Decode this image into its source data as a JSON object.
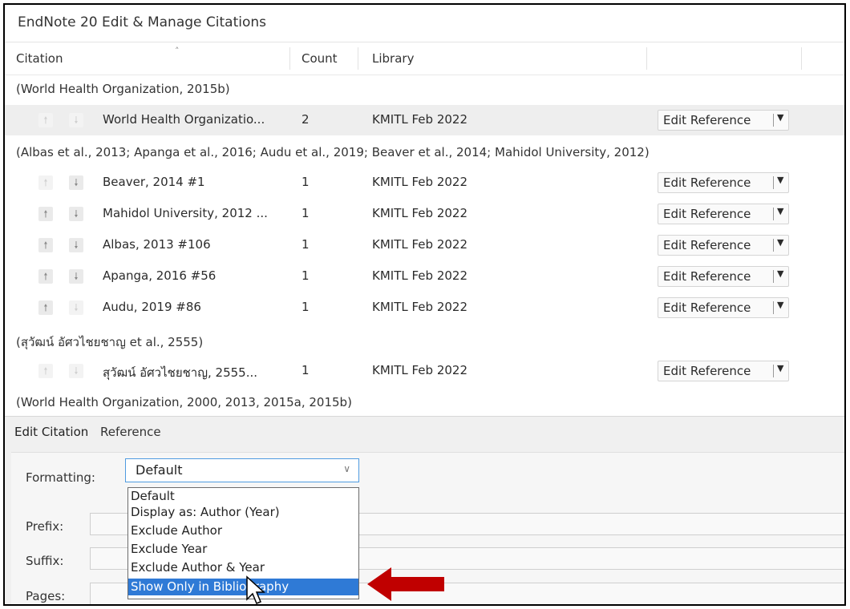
{
  "window": {
    "title": "EndNote 20 Edit & Manage Citations"
  },
  "columns": {
    "citation": "Citation",
    "count": "Count",
    "library": "Library"
  },
  "groups": [
    {
      "header": "(World Health Organization, 2015b)",
      "rows": [
        {
          "citation": "World Health Organizatio...",
          "count": "2",
          "library": "KMITL Feb 2022",
          "action": "Edit Reference"
        }
      ]
    },
    {
      "header": "(Albas et al., 2013; Apanga et al., 2016; Audu et al., 2019; Beaver et al., 2014; Mahidol University, 2012)",
      "rows": [
        {
          "citation": "Beaver, 2014 #1",
          "count": "1",
          "library": "KMITL Feb 2022",
          "action": "Edit Reference"
        },
        {
          "citation": "Mahidol University, 2012 ...",
          "count": "1",
          "library": "KMITL Feb 2022",
          "action": "Edit Reference"
        },
        {
          "citation": "Albas, 2013 #106",
          "count": "1",
          "library": "KMITL Feb 2022",
          "action": "Edit Reference"
        },
        {
          "citation": "Apanga, 2016 #56",
          "count": "1",
          "library": "KMITL Feb 2022",
          "action": "Edit Reference"
        },
        {
          "citation": "Audu, 2019 #86",
          "count": "1",
          "library": "KMITL Feb 2022",
          "action": "Edit Reference"
        }
      ]
    },
    {
      "header": "(สุวัฒน์ อัศวไชยชาญ et al., 2555)",
      "rows": [
        {
          "citation": "สุวัฒน์ อัศวไชยชาญ, 2555...",
          "count": "1",
          "library": "KMITL Feb 2022",
          "action": "Edit Reference"
        }
      ]
    },
    {
      "header": "(World Health Organization, 2000, 2013, 2015a, 2015b)",
      "rows": []
    }
  ],
  "editor": {
    "tabs": [
      "Edit Citation",
      "Reference"
    ],
    "formatting_label": "Formatting:",
    "formatting_value": "Default",
    "prefix_label": "Prefix:",
    "suffix_label": "Suffix:",
    "pages_label": "Pages:",
    "options": [
      "Default",
      "Display as: Author (Year)",
      "Exclude Author",
      "Exclude Year",
      "Exclude Author & Year",
      "Show Only in Bibliography"
    ],
    "highlighted_option": "Show Only in Bibliography"
  },
  "colors": {
    "accent": "#2f7ad6",
    "annotation_arrow": "#c00000"
  },
  "icons": [
    "sort-ascending-icon",
    "move-up-icon",
    "move-down-icon",
    "dropdown-arrow-icon",
    "mouse-cursor-icon",
    "red-pointer-arrow-icon"
  ]
}
